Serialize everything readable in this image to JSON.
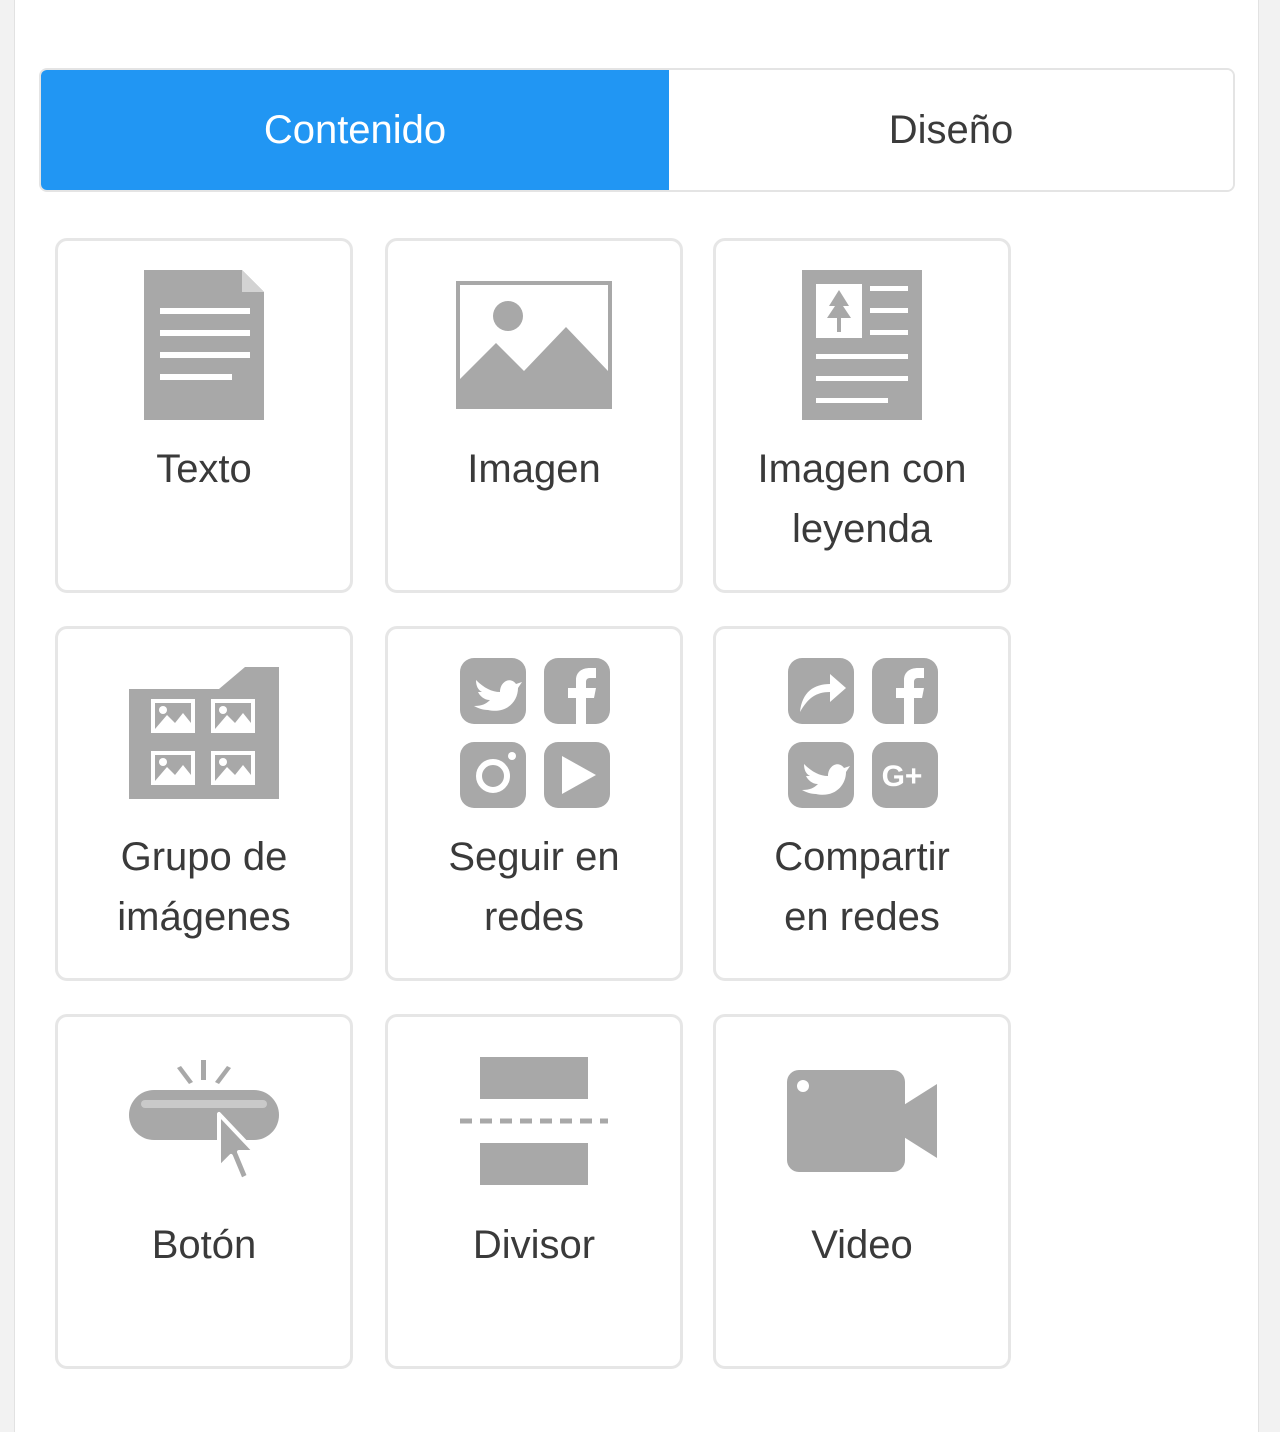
{
  "tabs": {
    "content": "Contenido",
    "design": "Diseño"
  },
  "colors": {
    "accent": "#2196f3",
    "icon": "#a8a8a8",
    "text": "#3a3a3a",
    "border": "#e6e6e6"
  },
  "blocks": [
    {
      "label": "Texto",
      "icon": "text-document-icon"
    },
    {
      "label": "Imagen",
      "icon": "image-icon"
    },
    {
      "label": "Imagen con leyenda",
      "icon": "image-caption-icon"
    },
    {
      "label": "Grupo de imágenes",
      "icon": "image-group-icon"
    },
    {
      "label": "Seguir en redes",
      "icon": "social-follow-icon"
    },
    {
      "label": "Compartir en redes",
      "icon": "social-share-icon"
    },
    {
      "label": "Botón",
      "icon": "button-click-icon"
    },
    {
      "label": "Divisor",
      "icon": "divider-icon"
    },
    {
      "label": "Video",
      "icon": "video-camera-icon"
    }
  ]
}
